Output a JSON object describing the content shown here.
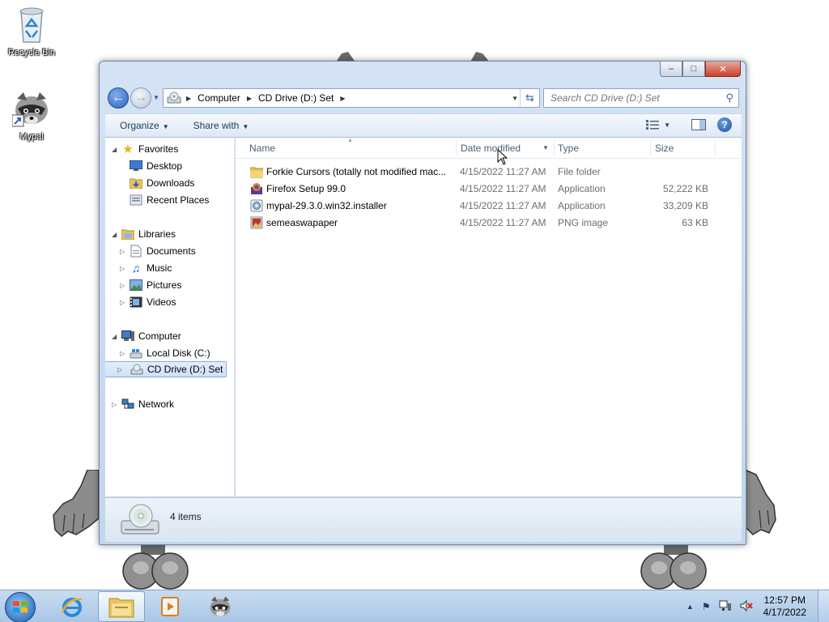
{
  "desktop": {
    "icons": [
      {
        "label": "Recycle Bin",
        "icon": "recycle-bin-icon"
      },
      {
        "label": "Mypal",
        "icon": "raccoon-icon"
      }
    ]
  },
  "window": {
    "minimize": "minimize",
    "maximize": "maximize",
    "close": "close"
  },
  "address": {
    "segments": [
      "Computer",
      "CD Drive (D:) Set"
    ],
    "search_placeholder": "Search CD Drive (D:) Set"
  },
  "toolbar": {
    "organize": "Organize",
    "share_with": "Share with"
  },
  "nav": {
    "favorites": "Favorites",
    "desktop": "Desktop",
    "downloads": "Downloads",
    "recent_places": "Recent Places",
    "libraries": "Libraries",
    "documents": "Documents",
    "music": "Music",
    "pictures": "Pictures",
    "videos": "Videos",
    "computer": "Computer",
    "local_disk": "Local Disk (C:)",
    "cd_drive": "CD Drive (D:) Set",
    "network": "Network"
  },
  "columns": {
    "name": "Name",
    "date_modified": "Date modified",
    "type": "Type",
    "size": "Size"
  },
  "files": [
    {
      "name": "Forkie Cursors (totally not modified mac...",
      "date": "4/15/2022 11:27 AM",
      "type": "File folder",
      "size": "",
      "icon": "folder-icon"
    },
    {
      "name": "Firefox Setup 99.0",
      "date": "4/15/2022 11:27 AM",
      "type": "Application",
      "size": "52,222 KB",
      "icon": "firefox-installer-icon"
    },
    {
      "name": "mypal-29.3.0.win32.installer",
      "date": "4/15/2022 11:27 AM",
      "type": "Application",
      "size": "33,209 KB",
      "icon": "installer-icon"
    },
    {
      "name": "semeaswapaper",
      "date": "4/15/2022 11:27 AM",
      "type": "PNG image",
      "size": "63 KB",
      "icon": "png-image-icon"
    }
  ],
  "status": {
    "count": "4 items"
  },
  "taskbar": {
    "time": "12:57 PM",
    "date": "4/17/2022"
  }
}
